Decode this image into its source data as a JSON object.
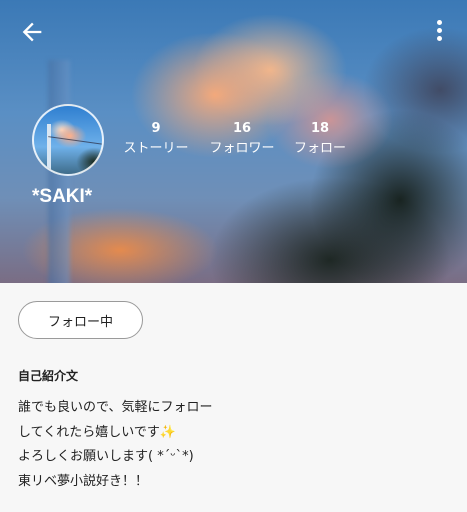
{
  "header": {
    "back_icon": "arrow-left-icon",
    "menu_icon": "more-vertical-icon"
  },
  "profile": {
    "username": "*SAKI*",
    "avatar": "profile-avatar-image"
  },
  "stats": {
    "stories": {
      "count": "9",
      "label": "ストーリー"
    },
    "followers": {
      "count": "16",
      "label": "フォロワー"
    },
    "following": {
      "count": "18",
      "label": "フォロー"
    }
  },
  "actions": {
    "follow_label": "フォロー中"
  },
  "bio": {
    "heading": "自己紹介文",
    "lines": [
      "誰でも良いので、気軽にフォロー",
      "してくれたら嬉しいです✨",
      "よろしくお願いします( *´ᵕ`*)",
      "東リベ夢小説好き！！"
    ]
  }
}
